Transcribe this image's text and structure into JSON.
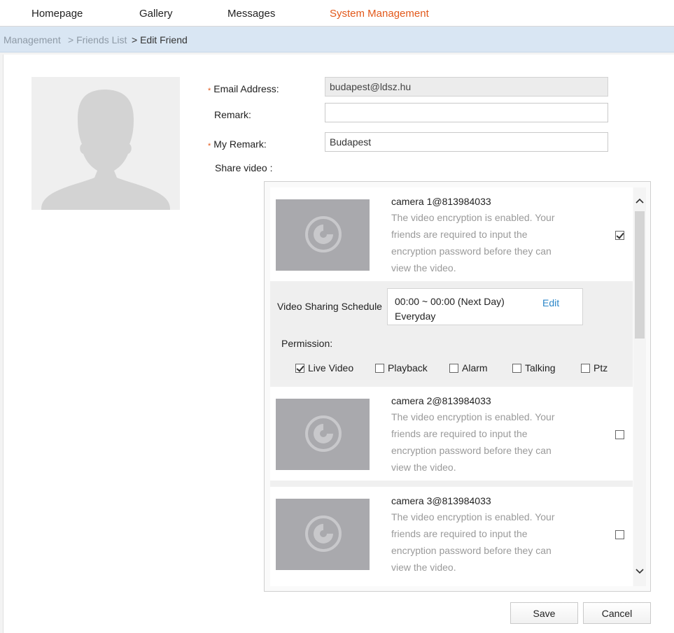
{
  "nav": {
    "items": [
      "Homepage",
      "Gallery",
      "Messages",
      "System Management"
    ],
    "active": "System Management"
  },
  "breadcrumb": [
    "Management",
    "> Friends List",
    "> Edit Friend"
  ],
  "form": {
    "email_label": "Email Address:",
    "email_value": "budapest@ldsz.hu",
    "remark_label": "Remark:",
    "remark_value": "",
    "my_remark_label": "My Remark:",
    "my_remark_value": "Budapest",
    "share_label": "Share video :"
  },
  "cameras": [
    {
      "title": "camera 1@813984033",
      "desc": "The video encryption is enabled. Your friends are required to input the encryption password before they can view the video.",
      "checked": true
    },
    {
      "title": "camera 2@813984033",
      "desc": "The video encryption is enabled. Your friends are required to input the encryption password before they can view the video.",
      "checked": false
    },
    {
      "title": "camera 3@813984033",
      "desc": "The video encryption is enabled. Your friends are required to input the encryption password before they can view the video.",
      "checked": false
    }
  ],
  "schedule": {
    "label": "Video Sharing Schedule",
    "time": "00:00 ~ 00:00 (Next Day)",
    "days": "Everyday",
    "edit_label": "Edit"
  },
  "permission": {
    "label": "Permission:",
    "options": [
      {
        "label": "Live Video",
        "checked": true
      },
      {
        "label": "Playback",
        "checked": false
      },
      {
        "label": "Alarm",
        "checked": false
      },
      {
        "label": "Talking",
        "checked": false
      },
      {
        "label": "Ptz",
        "checked": false
      }
    ]
  },
  "buttons": {
    "save": "Save",
    "cancel": "Cancel"
  },
  "colors": {
    "accent": "#e2581a",
    "link": "#2a86c8",
    "breadcrumb_bg": "#d9e6f3"
  }
}
